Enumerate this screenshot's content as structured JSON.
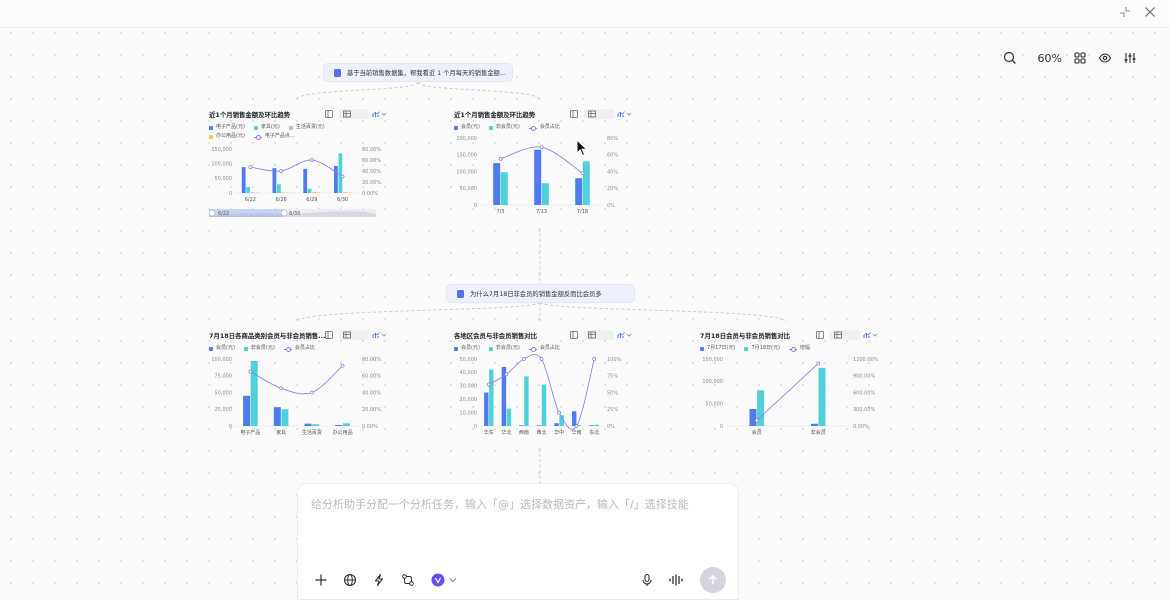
{
  "toolbar": {
    "zoom": "60%"
  },
  "questions": {
    "q1": "基于当前销售数据集，帮我看近 1 个月每天的销售金额...",
    "q2": "为什么7月18日非会员的销售金额反而比会员多"
  },
  "input": {
    "placeholder": "给分析助手分配一个分析任务，输入「@」选择数据资产，输入「/」选择技能"
  },
  "colors": {
    "blue": "#4e7cf0",
    "cyan": "#4fd1db",
    "pink": "#f3a9c8",
    "yellow": "#f2c94c",
    "purple": "#8a7ae8"
  },
  "icons": [
    "shrink-icon",
    "close-icon",
    "search-icon",
    "layout-grid-icon",
    "eye-icon",
    "settings-sliders-icon",
    "plus-icon",
    "globe-icon",
    "lightning-icon",
    "workflow-icon",
    "agent-icon",
    "microphone-icon",
    "voice-wave-icon",
    "send-arrow-icon"
  ],
  "chart_data": [
    {
      "type": "bar",
      "title": "近1个月销售金额及环比趋势",
      "categories": [
        "6/22",
        "6/26",
        "6/29",
        "6/30"
      ],
      "series": [
        {
          "name": "电子产品(元)",
          "values": [
            88000,
            85000,
            82000,
            92000
          ]
        },
        {
          "name": "家具(元)",
          "values": [
            20000,
            30000,
            15000,
            135000
          ]
        },
        {
          "name": "生活百货(元)",
          "values": [
            3000,
            2000,
            4000,
            3000
          ]
        },
        {
          "name": "办公用品(元)",
          "values": [
            1500,
            1000,
            2000,
            1500
          ]
        },
        {
          "name": "电子产品点...",
          "axis": "right",
          "values": [
            47,
            40,
            60,
            30
          ]
        }
      ],
      "legend_labels": [
        "电子产品(元)",
        "家具(元)",
        "生活百货(元)",
        "办公用品(元)",
        "电子产品点..."
      ],
      "y_ticks": [
        "150,000",
        "100,000",
        "50,000",
        "0"
      ],
      "y2_ticks": [
        "80.00%",
        "60.00%",
        "40.00%",
        "20.00%",
        "0.00%"
      ],
      "ylim": [
        0,
        150000
      ],
      "y2lim": [
        0,
        80
      ],
      "range_slider": {
        "start_label": "6/22",
        "end_label": "6/30",
        "value": [
          0,
          0.45
        ]
      }
    },
    {
      "type": "bar",
      "title": "近1个月销售金额及环比趋势",
      "categories": [
        "7/3",
        "7/13",
        "7/18"
      ],
      "series": [
        {
          "name": "会员(元)",
          "values": [
            125000,
            165000,
            80000
          ]
        },
        {
          "name": "非会员(元)",
          "values": [
            98000,
            65000,
            130000
          ]
        },
        {
          "name": "会员占比",
          "axis": "right",
          "values": [
            55,
            69,
            38
          ]
        }
      ],
      "legend_labels": [
        "会员(元)",
        "非会员(元)",
        "会员占比"
      ],
      "y_ticks": [
        "200,000",
        "150,000",
        "100,000",
        "50,000",
        "0"
      ],
      "y2_ticks": [
        "80%",
        "60%",
        "40%",
        "20%",
        "0%"
      ],
      "ylim": [
        0,
        200000
      ],
      "y2lim": [
        0,
        80
      ]
    },
    {
      "type": "bar",
      "title": "7月18日各商品类别会员与非会员销售...",
      "categories": [
        "电子产品",
        "家具",
        "生活百货",
        "办公用品"
      ],
      "series": [
        {
          "name": "会员(元)",
          "values": [
            45000,
            28000,
            3500,
            1500
          ]
        },
        {
          "name": "非会员(元)",
          "values": [
            97000,
            25000,
            2500,
            4000
          ]
        },
        {
          "name": "会员占比",
          "axis": "right",
          "values": [
            65,
            45,
            40,
            72
          ]
        }
      ],
      "legend_labels": [
        "会员(元)",
        "非会员(元)",
        "会员占比"
      ],
      "y_ticks": [
        "100,000",
        "75,000",
        "50,000",
        "25,000",
        "0"
      ],
      "y2_ticks": [
        "80.00%",
        "60.00%",
        "40.00%",
        "20.00%",
        "0.00%"
      ],
      "ylim": [
        0,
        100000
      ],
      "y2lim": [
        0,
        80
      ]
    },
    {
      "type": "bar",
      "title": "各地区会员与非会员销售对比",
      "categories": [
        "华东",
        "华北",
        "西南",
        "西北",
        "华中",
        "华南",
        "东北"
      ],
      "series": [
        {
          "name": "会员(元)",
          "values": [
            25000,
            44000,
            500,
            500,
            2000,
            11000,
            500
          ]
        },
        {
          "name": "非会员(元)",
          "values": [
            42000,
            13000,
            37000,
            31000,
            8000,
            500,
            1000
          ]
        },
        {
          "name": "会员占比",
          "axis": "right",
          "values": [
            62,
            77,
            100,
            100,
            20,
            0,
            100
          ]
        }
      ],
      "legend_labels": [
        "会员(元)",
        "非会员(元)",
        "会员占比"
      ],
      "y_ticks": [
        "50,000",
        "40,000",
        "30,000",
        "20,000",
        "10,000",
        "0"
      ],
      "y2_ticks": [
        "100%",
        "75%",
        "50%",
        "25%",
        "0%"
      ],
      "ylim": [
        0,
        50000
      ],
      "y2lim": [
        0,
        100
      ]
    },
    {
      "type": "bar",
      "title": "7月18日会员与非会员销售对比",
      "categories": [
        "会员",
        "非会员"
      ],
      "series": [
        {
          "name": "7月17日(元)",
          "values": [
            38000,
            5000
          ]
        },
        {
          "name": "7月18日(元)",
          "values": [
            80000,
            130000
          ]
        },
        {
          "name": "增幅",
          "axis": "right",
          "values": [
            100,
            1120
          ]
        }
      ],
      "legend_labels": [
        "7月17日(元)",
        "7月18日(元)",
        "增幅"
      ],
      "y_ticks": [
        "150,000",
        "100,000",
        "50,000",
        "0"
      ],
      "y2_ticks": [
        "1200.00%",
        "900.00%",
        "600.00%",
        "300.00%",
        "0.00%"
      ],
      "ylim": [
        0,
        150000
      ],
      "y2lim": [
        0,
        1200
      ]
    }
  ]
}
